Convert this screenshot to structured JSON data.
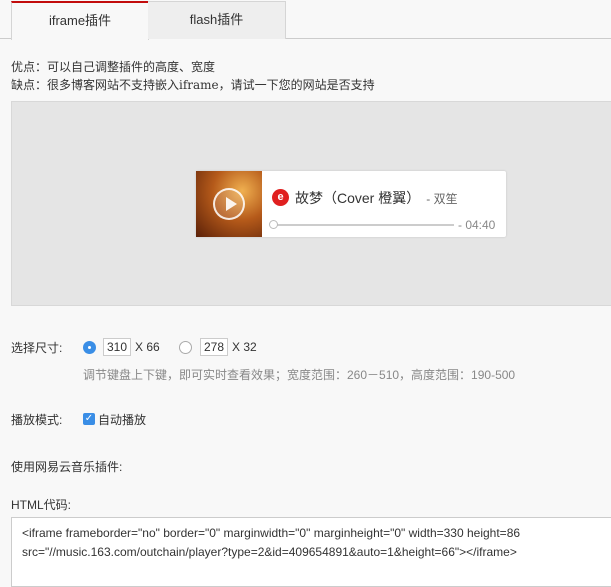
{
  "tabs": [
    {
      "label": "iframe插件",
      "active": true
    },
    {
      "label": "flash插件",
      "active": false
    }
  ],
  "notes": {
    "pros": "优点：可以自己调整插件的高度、宽度",
    "cons": "缺点：很多博客网站不支持嵌入iframe，请试一下您的网站是否支持"
  },
  "player": {
    "logo": "网易云音乐",
    "song": "故梦（Cover 橙翼）",
    "artist": "- 双笙",
    "time": "- 04:40",
    "progress": 0
  },
  "size": {
    "label": "选择尺寸:",
    "options": [
      {
        "width": "310",
        "height_label": "X 66",
        "selected": true
      },
      {
        "width": "278",
        "height_label": "X 32",
        "selected": false
      }
    ],
    "hint": "调节键盘上下键，即可实时查看效果；宽度范围：260－510，高度范围：190-500"
  },
  "playmode": {
    "label": "播放模式:",
    "autoplay_label": "自动播放",
    "autoplay": true
  },
  "use_label": "使用网易云音乐插件:",
  "html_code": {
    "label": "HTML代码:",
    "value": "<iframe frameborder=\"no\" border=\"0\" marginwidth=\"0\" marginheight=\"0\" width=330 height=86 src=\"//music.163.com/outchain/player?type=2&id=409654891&auto=1&height=66\"></iframe>"
  }
}
